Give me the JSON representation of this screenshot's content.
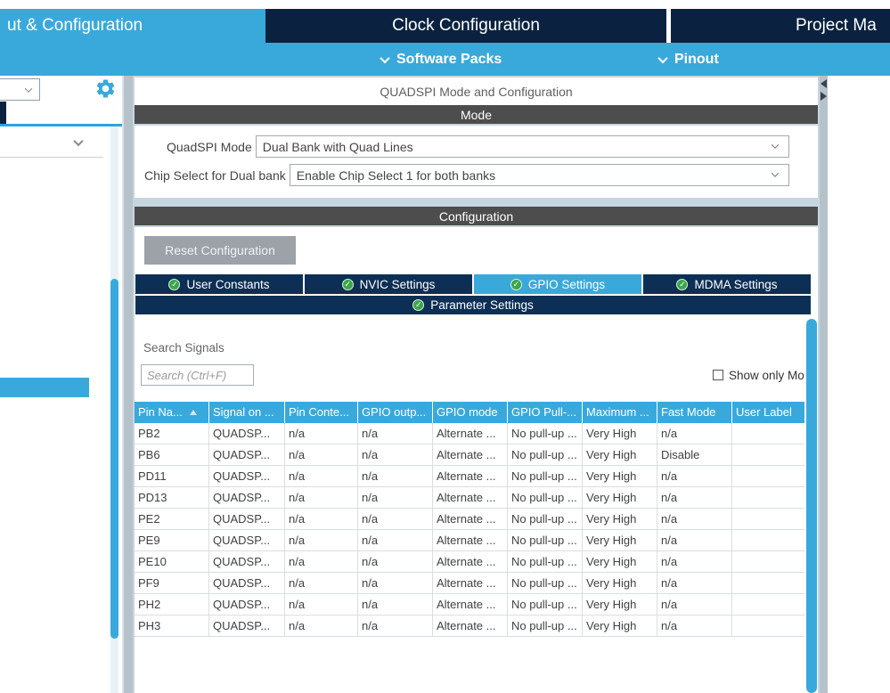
{
  "top_nav": {
    "tabs": [
      {
        "label": "ut & Configuration",
        "active": true
      },
      {
        "label": "Clock Configuration",
        "active": false
      },
      {
        "label": "Project Ma",
        "active": false
      }
    ],
    "sub_items": [
      {
        "label": "Software Packs"
      },
      {
        "label": "Pinout"
      }
    ]
  },
  "panel": {
    "title": "QUADSPI Mode and Configuration",
    "mode_section": {
      "header": "Mode",
      "fields": [
        {
          "label": "QuadSPI Mode",
          "value": "Dual Bank with Quad Lines"
        },
        {
          "label": "Chip Select for Dual bank",
          "value": "Enable Chip Select 1 for both banks"
        }
      ]
    },
    "config_section": {
      "header": "Configuration",
      "reset_button": "Reset Configuration",
      "tabs": [
        {
          "label": "User Constants",
          "active": false
        },
        {
          "label": "NVIC Settings",
          "active": false
        },
        {
          "label": "GPIO Settings",
          "active": true
        },
        {
          "label": "MDMA Settings",
          "active": false
        }
      ],
      "param_tab": "Parameter Settings",
      "gpio_tab": {
        "search_label": "Search Signals",
        "search_placeholder": "Search (Ctrl+F)",
        "show_only_label": "Show only Mo",
        "table": {
          "columns": [
            "Pin Na...",
            "Signal on ...",
            "Pin Conte...",
            "GPIO outp...",
            "GPIO mode",
            "GPIO Pull-...",
            "Maximum ...",
            "Fast Mode",
            "User Label"
          ],
          "rows": [
            [
              "PB2",
              "QUADSP...",
              "n/a",
              "n/a",
              "Alternate ...",
              "No pull-up ...",
              "Very High",
              "n/a",
              ""
            ],
            [
              "PB6",
              "QUADSP...",
              "n/a",
              "n/a",
              "Alternate ...",
              "No pull-up ...",
              "Very High",
              "Disable",
              ""
            ],
            [
              "PD11",
              "QUADSP...",
              "n/a",
              "n/a",
              "Alternate ...",
              "No pull-up ...",
              "Very High",
              "n/a",
              ""
            ],
            [
              "PD13",
              "QUADSP...",
              "n/a",
              "n/a",
              "Alternate ...",
              "No pull-up ...",
              "Very High",
              "n/a",
              ""
            ],
            [
              "PE2",
              "QUADSP...",
              "n/a",
              "n/a",
              "Alternate ...",
              "No pull-up ...",
              "Very High",
              "n/a",
              ""
            ],
            [
              "PE9",
              "QUADSP...",
              "n/a",
              "n/a",
              "Alternate ...",
              "No pull-up ...",
              "Very High",
              "n/a",
              ""
            ],
            [
              "PE10",
              "QUADSP...",
              "n/a",
              "n/a",
              "Alternate ...",
              "No pull-up ...",
              "Very High",
              "n/a",
              ""
            ],
            [
              "PF9",
              "QUADSP...",
              "n/a",
              "n/a",
              "Alternate ...",
              "No pull-up ...",
              "Very High",
              "n/a",
              ""
            ],
            [
              "PH2",
              "QUADSP...",
              "n/a",
              "n/a",
              "Alternate ...",
              "No pull-up ...",
              "Very High",
              "n/a",
              ""
            ],
            [
              "PH3",
              "QUADSP...",
              "n/a",
              "n/a",
              "Alternate ...",
              "No pull-up ...",
              "Very High",
              "n/a",
              ""
            ]
          ]
        }
      }
    }
  },
  "colors": {
    "brand_blue": "#39A9DC",
    "top_navy": "#0A2240",
    "tab_navy": "#0E2F55",
    "section_header_gray": "#4D4D4D",
    "check_green": "#3BA64A"
  }
}
